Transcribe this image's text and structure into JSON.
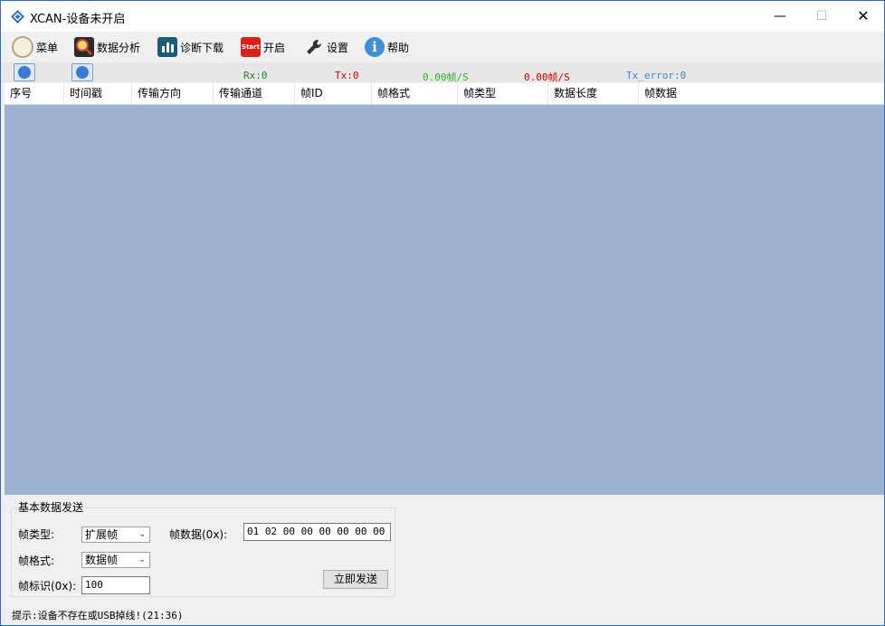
{
  "window": {
    "title": "XCAN-设备未开启"
  },
  "toolbar": {
    "menu": "菜单",
    "analysis": "数据分析",
    "diagnose": "诊断下载",
    "start_icon_text": "Start",
    "start": "开启",
    "settings": "设置",
    "help": "帮助"
  },
  "status": {
    "rx": "Rx:0",
    "tx": "Tx:0",
    "rx_rate": "0.00帧/S",
    "tx_rate": "0.00帧/S",
    "tx_error": "Tx_error:0"
  },
  "table": {
    "columns": [
      "序号",
      "时间戳",
      "传输方向",
      "传输通道",
      "帧ID",
      "帧格式",
      "帧类型",
      "数据长度",
      "帧数据"
    ],
    "rows": []
  },
  "send_panel": {
    "title": "基本数据发送",
    "frame_type_label": "帧类型:",
    "frame_type_value": "扩展帧",
    "frame_format_label": "帧格式:",
    "frame_format_value": "数据帧",
    "frame_id_label": "帧标识(0x):",
    "frame_id_value": "100",
    "frame_data_label": "帧数据(0x):",
    "frame_data_value": "01 02 00 00 00 00 00 00",
    "send_button": "立即发送"
  },
  "hint": "提示:设备不存在或USB掉线!(21:36)",
  "colors": {
    "grid_background": "#9bb3d1",
    "rx": "#1a8a1a",
    "tx": "#d00000",
    "tx_error": "#3a8ad6"
  }
}
